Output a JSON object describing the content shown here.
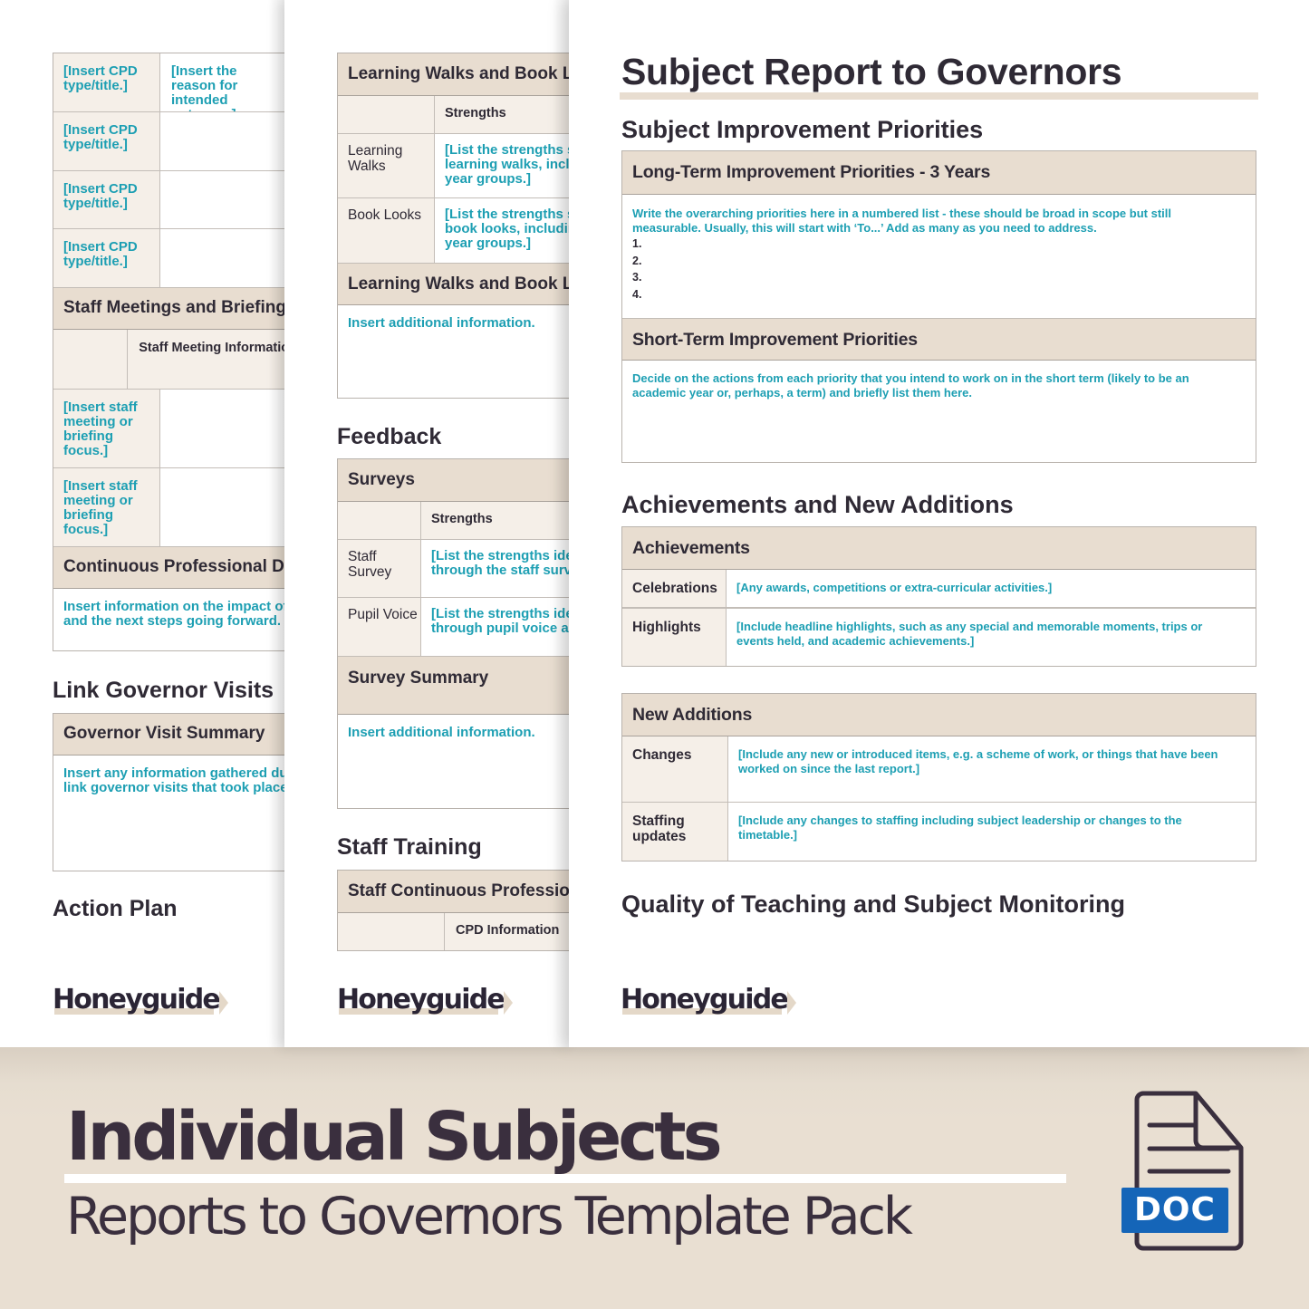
{
  "brand": {
    "logo_text": "Honeyguide",
    "colors": {
      "header_fill": "#e8ddd0",
      "label_fill": "#f5efe8",
      "placeholder_text": "#1d9fb3",
      "heading_text": "#2f2a35",
      "band_background": "#e9dfd2",
      "doc_badge": "#1565b8"
    }
  },
  "page1": {
    "cpd_rows": [
      {
        "label": "[Insert CPD type/title.]",
        "value": "[Insert the reason for intended outcome.]"
      },
      {
        "label": "[Insert CPD type/title.]",
        "value": ""
      },
      {
        "label": "[Insert CPD type/title.]",
        "value": ""
      },
      {
        "label": "[Insert CPD type/title.]",
        "value": ""
      }
    ],
    "staff_meetings": {
      "header": "Staff Meetings and Briefings",
      "column_header": "Staff Meeting Information",
      "rows": [
        {
          "label": "[Insert staff meeting or briefing focus.]",
          "value": ""
        },
        {
          "label": "[Insert staff meeting or briefing focus.]",
          "value": ""
        }
      ]
    },
    "cpd_impact": {
      "header": "Continuous Professional Development",
      "text": "Insert information on the impact of the CPD and the next steps going forward."
    },
    "link_governor_heading": "Link Governor Visits",
    "governor_visit": {
      "header": "Governor Visit Summary",
      "text": "Insert any information gathered during the link governor visits that took place."
    },
    "action_plan_heading": "Action Plan"
  },
  "page2": {
    "learning_walks": {
      "header": "Learning Walks and Book Looks",
      "column_header": "Strengths",
      "rows": [
        {
          "label": "Learning Walks",
          "value": "[List the strengths seen during learning walks, including specific year groups.]"
        },
        {
          "label": "Book Looks",
          "value": "[List the strengths seen during book looks, including specific year groups.]"
        }
      ]
    },
    "learning_walks_summary": {
      "header": "Learning Walks and Book Looks Summary",
      "text": "Insert additional information."
    },
    "feedback_heading": "Feedback",
    "surveys": {
      "header": "Surveys",
      "column_header": "Strengths",
      "rows": [
        {
          "label": "Staff Survey",
          "value": "[List the strengths identified through the staff survey.]"
        },
        {
          "label": "Pupil Voice",
          "value": "[List the strengths identified through pupil voice activities.]"
        }
      ]
    },
    "survey_summary": {
      "header": "Survey Summary",
      "text": "Insert additional information."
    },
    "staff_training_heading": "Staff Training",
    "staff_cpd": {
      "header": "Staff Continuous Professional Development",
      "column_header": "CPD Information"
    }
  },
  "page3": {
    "title": "Subject Report to Governors",
    "improvement_heading": "Subject Improvement Priorities",
    "long_term": {
      "header": "Long-Term Improvement Priorities - 3 Years",
      "text": "Write the overarching priorities here in a numbered list - these should be broad in scope but still measurable. Usually, this will start with ‘To...’ Add as many as you need to address.",
      "list": [
        "1.",
        "2.",
        "3.",
        "4."
      ]
    },
    "short_term": {
      "header": "Short-Term Improvement Priorities",
      "text": "Decide on the actions from each priority that you intend to work on in the short term (likely to be an academic year or, perhaps, a term) and briefly list them here."
    },
    "achievements_heading": "Achievements and New Additions",
    "achievements": {
      "header": "Achievements",
      "rows": [
        {
          "label": "Celebrations",
          "value": "[Any awards, competitions or extra-curricular activities.]"
        },
        {
          "label": "Highlights",
          "value": "[Include headline highlights, such as any special and memorable moments, trips or events held, and academic achievements.]"
        }
      ]
    },
    "new_additions": {
      "header": "New Additions",
      "rows": [
        {
          "label": "Changes",
          "value": "[Include any new or introduced items, e.g. a scheme of work, or things that have been worked on since the last report.]"
        },
        {
          "label": "Staffing updates",
          "value": "[Include any changes to staffing including subject leadership or changes to the timetable.]"
        }
      ]
    },
    "quality_heading": "Quality of Teaching and Subject Monitoring"
  },
  "banner": {
    "title": "Individual Subjects",
    "subtitle": "Reports to Governors Template Pack",
    "file_badge": "DOC",
    "file_icon": "document-icon"
  }
}
